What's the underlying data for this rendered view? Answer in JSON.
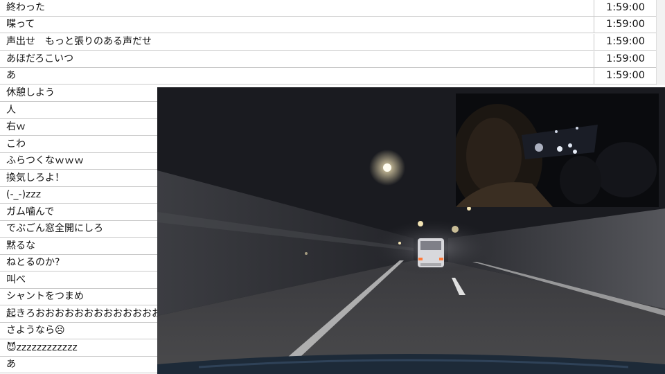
{
  "comments_top": [
    {
      "text": "終わった",
      "time": "1:59:00"
    },
    {
      "text": "喋って",
      "time": "1:59:00"
    },
    {
      "text": "声出せ　もっと張りのある声だせ",
      "time": "1:59:00"
    },
    {
      "text": "あほだろこいつ",
      "time": "1:59:00"
    },
    {
      "text": "あ",
      "time": "1:59:00"
    }
  ],
  "comments_left": [
    {
      "text": "休憩しよう"
    },
    {
      "text": "人"
    },
    {
      "text": "右ｗ"
    },
    {
      "text": "こわ"
    },
    {
      "text": "ふらつくなｗｗｗ"
    },
    {
      "text": "換気しろよ！"
    },
    {
      "text": "(-_-)zzz"
    },
    {
      "text": "ガム噛んで"
    },
    {
      "text": "でぶごん窓全開にしろ"
    },
    {
      "text": "黙るな"
    },
    {
      "text": "ねとるのか?"
    },
    {
      "text": "叫べ"
    },
    {
      "text": "シャントをつまめ"
    },
    {
      "text": "起きろおおおおおおおおおおおおお"
    },
    {
      "text": "さようなら☹"
    },
    {
      "text": "😈zzzzzzzzzzzz"
    },
    {
      "text": "あ"
    }
  ],
  "video": {
    "scene": "night-tunnel-driving",
    "pip_scene": "driver-webcam"
  }
}
